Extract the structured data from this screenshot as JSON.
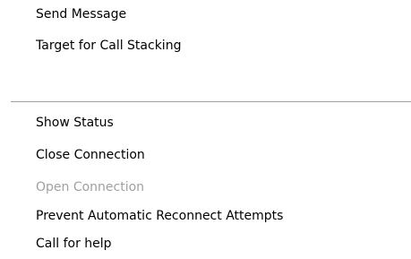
{
  "menu": {
    "items_top": [
      {
        "label": "Send Message",
        "enabled": true
      },
      {
        "label": "Target for Call Stacking",
        "enabled": true
      }
    ],
    "items_bottom": [
      {
        "label": "Show Status",
        "enabled": true
      },
      {
        "label": "Close Connection",
        "enabled": true
      },
      {
        "label": "Open Connection",
        "enabled": false
      },
      {
        "label": "Prevent Automatic Reconnect Attempts",
        "enabled": true
      },
      {
        "label": "Call for help",
        "enabled": true
      }
    ]
  },
  "colors": {
    "enabled_text": "#000000",
    "disabled_text": "#a0a0a0",
    "separator": "#a0a0a0",
    "background": "#ffffff"
  }
}
